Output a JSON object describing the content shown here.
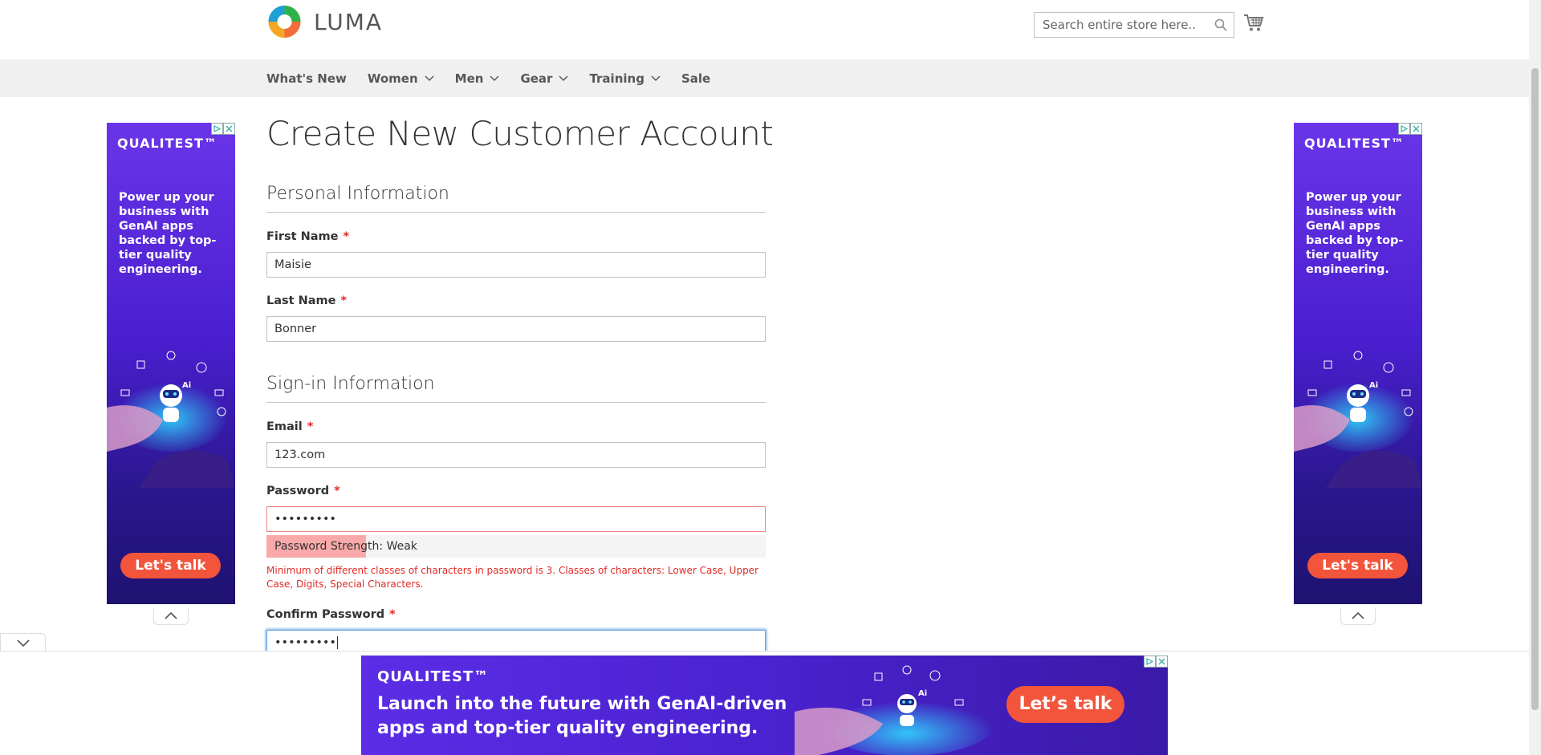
{
  "header": {
    "logo_text": "LUMA",
    "search": {
      "placeholder": "Search entire store here..."
    }
  },
  "nav": {
    "items": [
      {
        "label": "What's New",
        "has_menu": false
      },
      {
        "label": "Women",
        "has_menu": true
      },
      {
        "label": "Men",
        "has_menu": true
      },
      {
        "label": "Gear",
        "has_menu": true
      },
      {
        "label": "Training",
        "has_menu": true
      },
      {
        "label": "Sale",
        "has_menu": false
      }
    ]
  },
  "page": {
    "title": "Create New Customer Account"
  },
  "form": {
    "personal_legend": "Personal Information",
    "signin_legend": "Sign-in Information",
    "required_marker": "*",
    "first_name": {
      "label": "First Name",
      "value": "Maisie"
    },
    "last_name": {
      "label": "Last Name",
      "value": "Bonner"
    },
    "email": {
      "label": "Email",
      "value": "123.com"
    },
    "password": {
      "label": "Password",
      "value": "•••••••••"
    },
    "password_strength": {
      "text": "Password Strength: Weak",
      "fraction": 0.2
    },
    "password_error": "Minimum of different classes of characters in password is 3. Classes of characters: Lower Case, Upper Case, Digits, Special Characters.",
    "confirm_password": {
      "label": "Confirm Password",
      "value": "•••••••••"
    }
  },
  "ads": {
    "side": {
      "brand": "QUALITEST™",
      "copy": "Power up your business with GenAI apps backed by top-tier quality engineering.",
      "cta": "Let's talk"
    },
    "bottom": {
      "brand": "QUALITEST™",
      "copy": "Launch into the future with GenAI-driven apps and top-tier quality engineering.",
      "cta": "Let’s talk"
    }
  },
  "colors": {
    "accent_orange": "#f2553c",
    "ad_purple": "#5b2de6",
    "error_red": "#e02b27",
    "nav_bg": "#f0f0f0"
  }
}
